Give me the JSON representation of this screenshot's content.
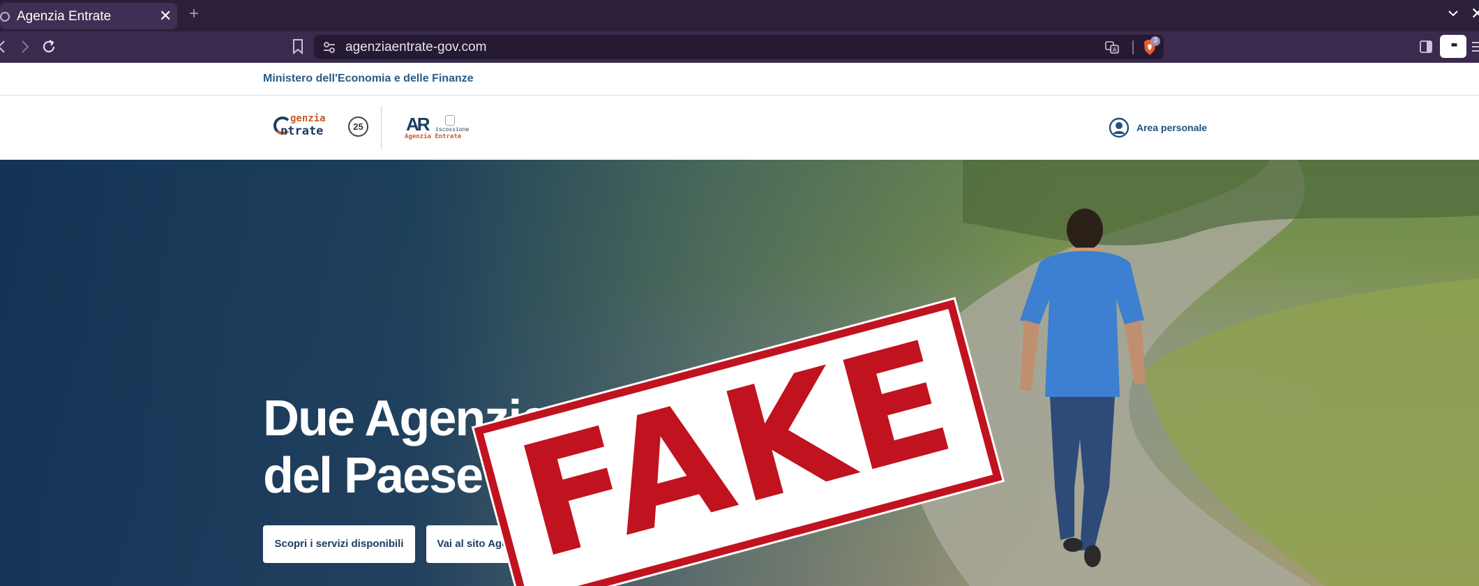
{
  "browser": {
    "tab": {
      "title": "Agenzia Entrate",
      "close_glyph": "✕"
    },
    "new_tab_glyph": "+",
    "window_close_glyph": "✕",
    "address": "agenziaentrate-gov.com",
    "shields_count": "3",
    "leo_glyph": "▪▪",
    "icons": [
      "back-icon",
      "forward-icon",
      "reload-icon",
      "bookmark-icon",
      "site-info-icon",
      "translate-icon",
      "brave-shields-icon",
      "sidebar-icon",
      "menu-icon"
    ]
  },
  "page": {
    "ministry": "Ministero dell'Economia e delle Finanze",
    "logos": {
      "agenzia_line1": "genzia",
      "agenzia_line2": "ntrate",
      "anniversary": "25",
      "riscossione_mark": "AR",
      "riscossione_line1": "iscossione",
      "riscossione_line2": "Agenzia Entrate"
    },
    "area_personale": "Area personale",
    "hero": {
      "title_line1": "Due Agenzie al servizio",
      "title_line2": "del Paese",
      "button_services": "Scopri i servizi disponibili",
      "button_riscossione": "Vai al sito Agenzia delle entrate-Riscossione"
    },
    "stamp": "FAKE"
  },
  "colors": {
    "chrome_dark": "#2b1f3a",
    "chrome_nav": "#3a2a4e",
    "brand_blue": "#1e3c63",
    "brand_orange": "#c65d2b",
    "stamp_red": "#c1121f"
  }
}
